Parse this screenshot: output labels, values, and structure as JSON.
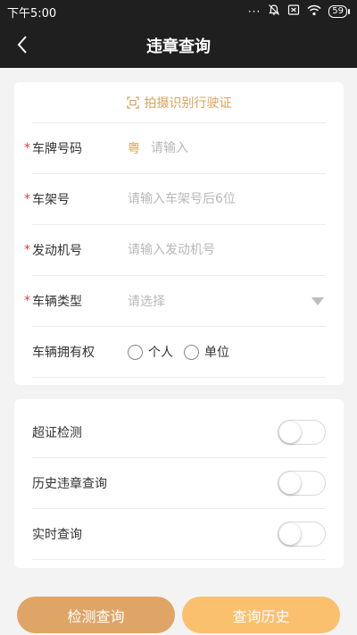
{
  "status": {
    "time": "下午5:00",
    "battery": "59",
    "dots": "···"
  },
  "nav": {
    "title": "违章查询"
  },
  "scan": {
    "label": "拍摄识别行驶证"
  },
  "form": {
    "plate": {
      "label": "车牌号码",
      "prefix": "粤",
      "placeholder": "请输入"
    },
    "frame": {
      "label": "车架号",
      "placeholder": "请输入车架号后6位"
    },
    "engine": {
      "label": "发动机号",
      "placeholder": "请输入发动机号"
    },
    "type": {
      "label": "车辆类型",
      "placeholder": "请选择"
    },
    "owner": {
      "label": "车辆拥有权",
      "options": [
        "个人",
        "单位"
      ]
    },
    "required_mark": "*"
  },
  "toggles": [
    {
      "label": "超证检测"
    },
    {
      "label": "历史违章查询"
    },
    {
      "label": "实时查询"
    }
  ],
  "buttons": {
    "detect": "检测查询",
    "history": "查询历史"
  },
  "colors": {
    "accent": "#d9a25b",
    "required": "#e23b3b",
    "bar": "#1f1f1f"
  }
}
